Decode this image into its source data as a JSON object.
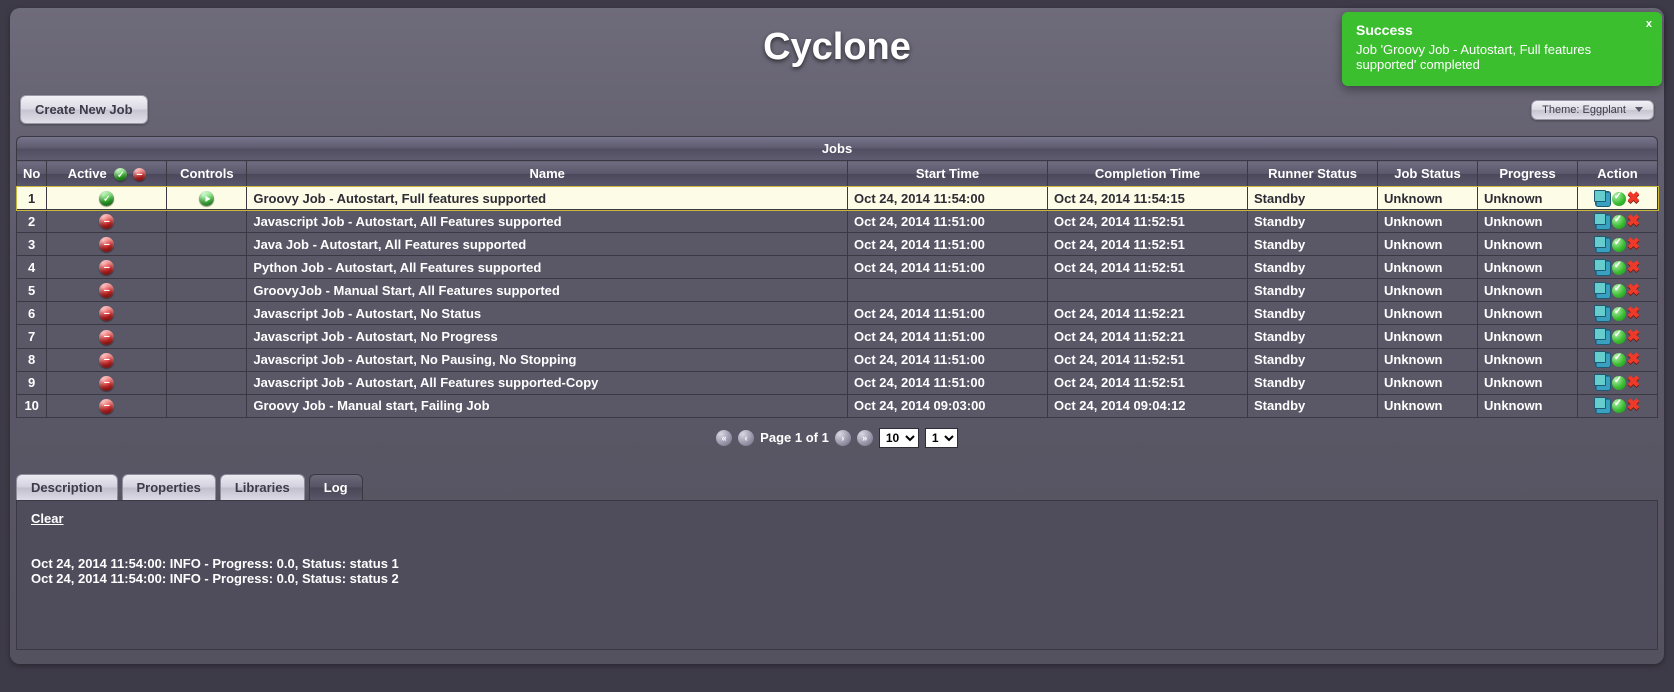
{
  "app_title": "Cyclone",
  "toast": {
    "title": "Success",
    "message": "Job 'Groovy Job - Autostart, Full features supported' completed",
    "close": "x"
  },
  "toolbar": {
    "create": "Create New Job",
    "theme": "Theme: Eggplant"
  },
  "jobs_title": "Jobs",
  "columns": {
    "no": "No",
    "active": "Active",
    "controls": "Controls",
    "name": "Name",
    "start": "Start Time",
    "completion": "Completion Time",
    "runner": "Runner Status",
    "jstat": "Job Status",
    "progress": "Progress",
    "action": "Action"
  },
  "rows": [
    {
      "no": "1",
      "active": "green",
      "play": true,
      "name": "Groovy Job - Autostart, Full features supported",
      "start": "Oct 24, 2014 11:54:00",
      "completion": "Oct 24, 2014 11:54:15",
      "runner": "Standby",
      "jstat": "Unknown",
      "progress": "Unknown",
      "selected": true
    },
    {
      "no": "2",
      "active": "red",
      "play": false,
      "name": "Javascript Job - Autostart, All Features supported",
      "start": "Oct 24, 2014 11:51:00",
      "completion": "Oct 24, 2014 11:52:51",
      "runner": "Standby",
      "jstat": "Unknown",
      "progress": "Unknown"
    },
    {
      "no": "3",
      "active": "red",
      "play": false,
      "name": "Java Job - Autostart, All Features supported",
      "start": "Oct 24, 2014 11:51:00",
      "completion": "Oct 24, 2014 11:52:51",
      "runner": "Standby",
      "jstat": "Unknown",
      "progress": "Unknown"
    },
    {
      "no": "4",
      "active": "red",
      "play": false,
      "name": "Python Job - Autostart, All Features supported",
      "start": "Oct 24, 2014 11:51:00",
      "completion": "Oct 24, 2014 11:52:51",
      "runner": "Standby",
      "jstat": "Unknown",
      "progress": "Unknown"
    },
    {
      "no": "5",
      "active": "red",
      "play": false,
      "name": "GroovyJob - Manual Start, All Features supported",
      "start": "",
      "completion": "",
      "runner": "Standby",
      "jstat": "Unknown",
      "progress": "Unknown"
    },
    {
      "no": "6",
      "active": "red",
      "play": false,
      "name": "Javascript Job - Autostart, No Status",
      "start": "Oct 24, 2014 11:51:00",
      "completion": "Oct 24, 2014 11:52:21",
      "runner": "Standby",
      "jstat": "Unknown",
      "progress": "Unknown"
    },
    {
      "no": "7",
      "active": "red",
      "play": false,
      "name": "Javascript Job - Autostart, No Progress",
      "start": "Oct 24, 2014 11:51:00",
      "completion": "Oct 24, 2014 11:52:21",
      "runner": "Standby",
      "jstat": "Unknown",
      "progress": "Unknown"
    },
    {
      "no": "8",
      "active": "red",
      "play": false,
      "name": "Javascript Job - Autostart, No Pausing, No Stopping",
      "start": "Oct 24, 2014 11:51:00",
      "completion": "Oct 24, 2014 11:52:51",
      "runner": "Standby",
      "jstat": "Unknown",
      "progress": "Unknown"
    },
    {
      "no": "9",
      "active": "red",
      "play": false,
      "name": "Javascript Job - Autostart, All Features supported-Copy",
      "start": "Oct 24, 2014 11:51:00",
      "completion": "Oct 24, 2014 11:52:51",
      "runner": "Standby",
      "jstat": "Unknown",
      "progress": "Unknown"
    },
    {
      "no": "10",
      "active": "red",
      "play": false,
      "name": "Groovy Job - Manual start, Failing Job",
      "start": "Oct 24, 2014 09:03:00",
      "completion": "Oct 24, 2014 09:04:12",
      "runner": "Standby",
      "jstat": "Unknown",
      "progress": "Unknown"
    }
  ],
  "pager": {
    "label": "Page 1 of 1",
    "size_options": [
      "10"
    ],
    "size_value": "10",
    "page_options": [
      "1"
    ],
    "page_value": "1"
  },
  "tabs": {
    "description": "Description",
    "properties": "Properties",
    "libraries": "Libraries",
    "log": "Log",
    "active": "log"
  },
  "log": {
    "clear": "Clear",
    "lines": [
      "Oct 24, 2014 11:54:00: INFO - Progress: 0.0, Status: status 1",
      "Oct 24, 2014 11:54:00: INFO - Progress: 0.0, Status: status 2"
    ]
  }
}
